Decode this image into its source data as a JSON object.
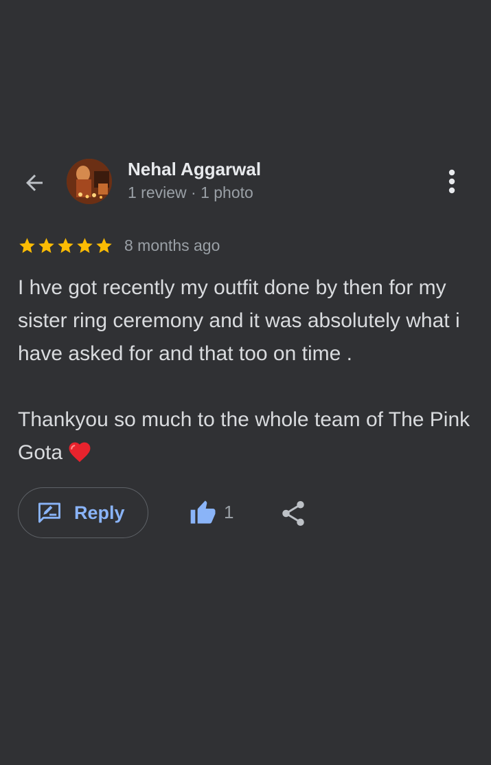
{
  "header": {
    "author_name": "Nehal Aggarwal",
    "author_meta": "1 review · 1 photo"
  },
  "review": {
    "rating": 5,
    "time_ago": "8 months ago",
    "text": "I hve got recently my outfit done by then for my sister ring ceremony and it was absolutely what i have asked for and that too on time .\n\nThankyou so much to the whole team of The Pink Gota",
    "emoji": "red-heart"
  },
  "actions": {
    "reply_label": "Reply",
    "like_count": "1"
  },
  "colors": {
    "background": "#303134",
    "star": "#fbbc04",
    "accent": "#8ab4f8",
    "secondary_text": "#9aa0a6",
    "heart": "#e8232d"
  },
  "icons": {
    "back": "arrow-back-icon",
    "more": "more-vert-icon",
    "reply": "rate-review-icon",
    "like": "thumb-up-icon",
    "share": "share-icon"
  }
}
